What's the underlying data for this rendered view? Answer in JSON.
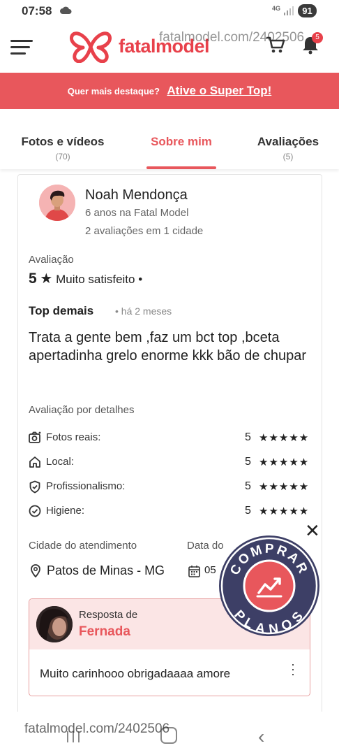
{
  "status_bar": {
    "time": "07:58",
    "network": "4G",
    "battery": "91"
  },
  "header": {
    "brand_left": "fatal",
    "brand_right": "model",
    "watermark": "fatalmodel.com/2402506",
    "notification_count": "5"
  },
  "promo": {
    "question": "Quer mais destaque?",
    "action": "Ative o Super Top!"
  },
  "tabs": [
    {
      "label": "Fotos e vídeos",
      "count": "(70)"
    },
    {
      "label": "Sobre mim",
      "count": ""
    },
    {
      "label": "Avaliações",
      "count": "(5)"
    }
  ],
  "active_tab": "Sobre mim",
  "review": {
    "reviewer_name": "Noah Mendonça",
    "reviewer_tenure": "6 anos na Fatal Model",
    "reviewer_stats": "2 avaliações em 1 cidade",
    "rating_label": "Avaliação",
    "rating_value": "5",
    "rating_text": "Muito satisfeito",
    "title": "Top demais",
    "when": "há 2 meses",
    "text": "Trata a gente bem ,faz um bct top ,bceta apertadinha grelo enorme kkk bão de chupar",
    "details_label": "Avaliação por detalhes",
    "details": [
      {
        "name": "Fotos reais:",
        "score": "5",
        "icon": "camera-icon"
      },
      {
        "name": "Local:",
        "score": "5",
        "icon": "home-icon"
      },
      {
        "name": "Profissionalismo:",
        "score": "5",
        "icon": "shield-check-icon"
      },
      {
        "name": "Higiene:",
        "score": "5",
        "icon": "check-circle-icon"
      }
    ],
    "stars_text": "★★★★★",
    "city_label": "Cidade do atendimento",
    "city_value": "Patos de Minas - MG",
    "date_label": "Data do",
    "date_value": "05"
  },
  "reply": {
    "by_label": "Resposta de",
    "name": "Fernada",
    "text": "Muito carinhooo obrigadaaaa amore"
  },
  "floating_badge": {
    "top_text": "COMPRAR",
    "bottom_text": "PLANOS"
  },
  "colors": {
    "accent": "#e8575c",
    "badge_bg": "#3d3f66"
  }
}
